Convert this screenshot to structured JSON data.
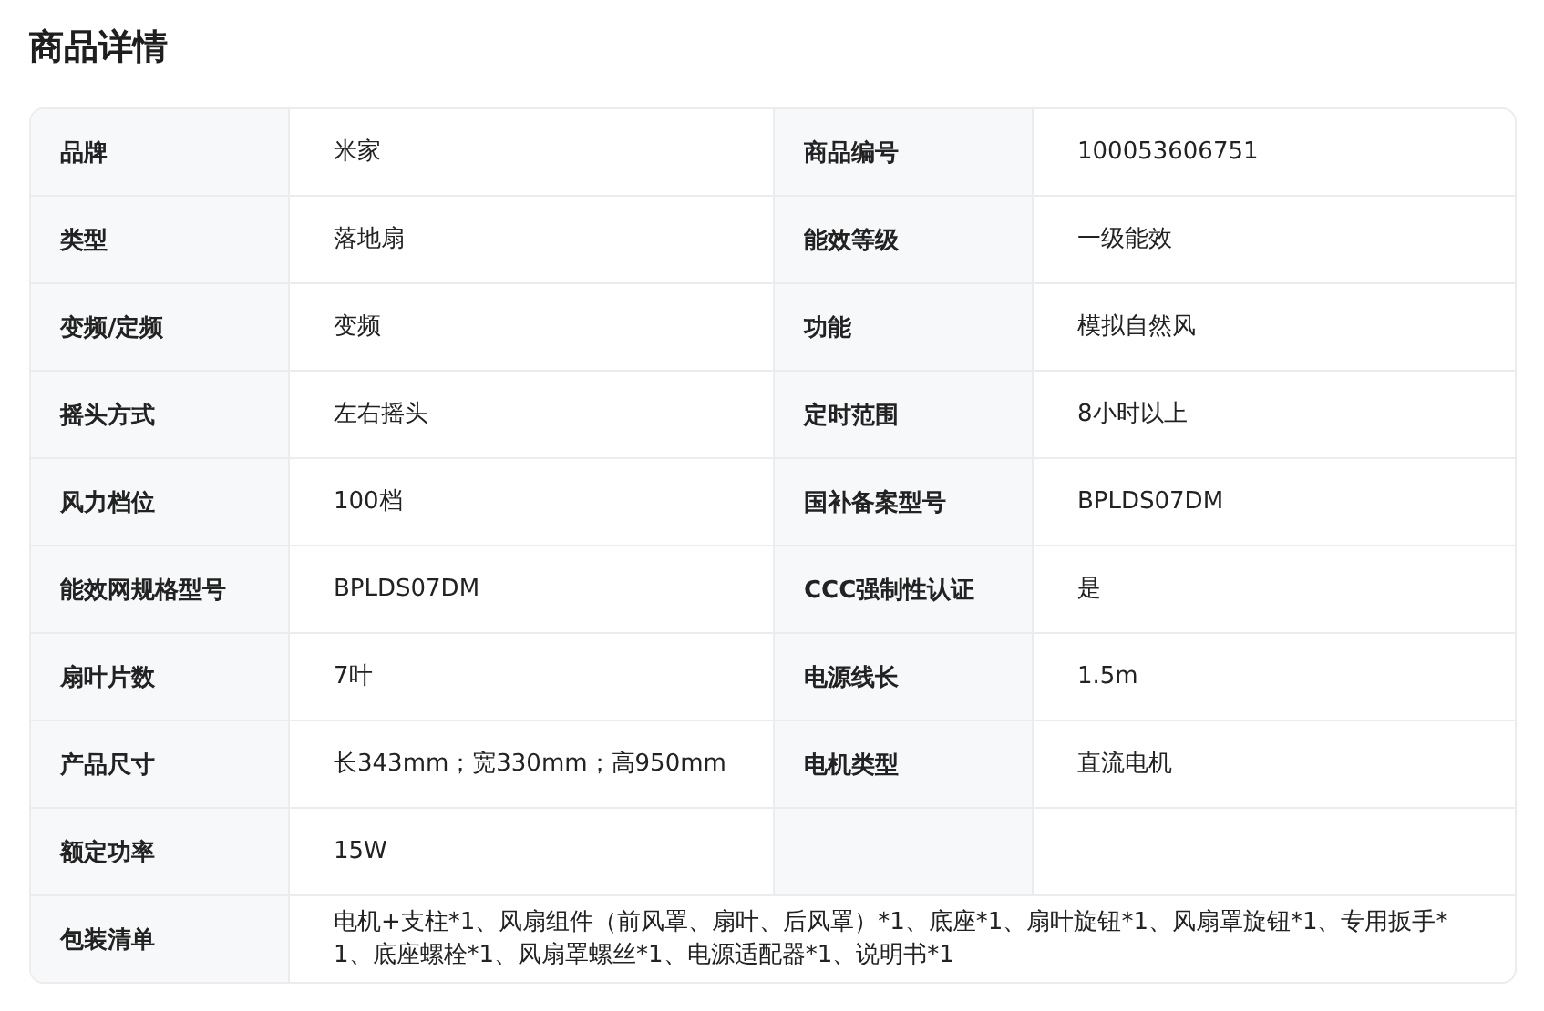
{
  "title": "商品详情",
  "rows": [
    {
      "kind": "pair",
      "specs": [
        {
          "label": "品牌",
          "value": "米家"
        },
        {
          "label": "商品编号",
          "value": "100053606751"
        }
      ]
    },
    {
      "kind": "pair",
      "specs": [
        {
          "label": "类型",
          "value": "落地扇"
        },
        {
          "label": "能效等级",
          "value": "一级能效"
        }
      ]
    },
    {
      "kind": "pair",
      "specs": [
        {
          "label": "变频/定频",
          "value": "变频"
        },
        {
          "label": "功能",
          "value": "模拟自然风"
        }
      ]
    },
    {
      "kind": "pair",
      "specs": [
        {
          "label": "摇头方式",
          "value": "左右摇头"
        },
        {
          "label": "定时范围",
          "value": "8小时以上"
        }
      ]
    },
    {
      "kind": "pair",
      "specs": [
        {
          "label": "风力档位",
          "value": "100档"
        },
        {
          "label": "国补备案型号",
          "value": "BPLDS07DM"
        }
      ]
    },
    {
      "kind": "pair",
      "specs": [
        {
          "label": "能效网规格型号",
          "value": "BPLDS07DM"
        },
        {
          "label": "CCC强制性认证",
          "value": "是"
        }
      ]
    },
    {
      "kind": "pair",
      "specs": [
        {
          "label": "扇叶片数",
          "value": "7叶"
        },
        {
          "label": "电源线长",
          "value": "1.5m"
        }
      ]
    },
    {
      "kind": "pair",
      "specs": [
        {
          "label": "产品尺寸",
          "value": "长343mm；宽330mm；高950mm"
        },
        {
          "label": "电机类型",
          "value": "直流电机"
        }
      ]
    },
    {
      "kind": "pair",
      "specs": [
        {
          "label": "额定功率",
          "value": "15W"
        }
      ]
    },
    {
      "kind": "full",
      "specs": [
        {
          "label": "包装清单",
          "value": "电机+支柱*1、风扇组件（前风罩、扇叶、后风罩）*1、底座*1、扇叶旋钮*1、风扇罩旋钮*1、专用扳手*1、底座螺栓*1、风扇罩螺丝*1、电源适配器*1、说明书*1"
        }
      ]
    }
  ]
}
